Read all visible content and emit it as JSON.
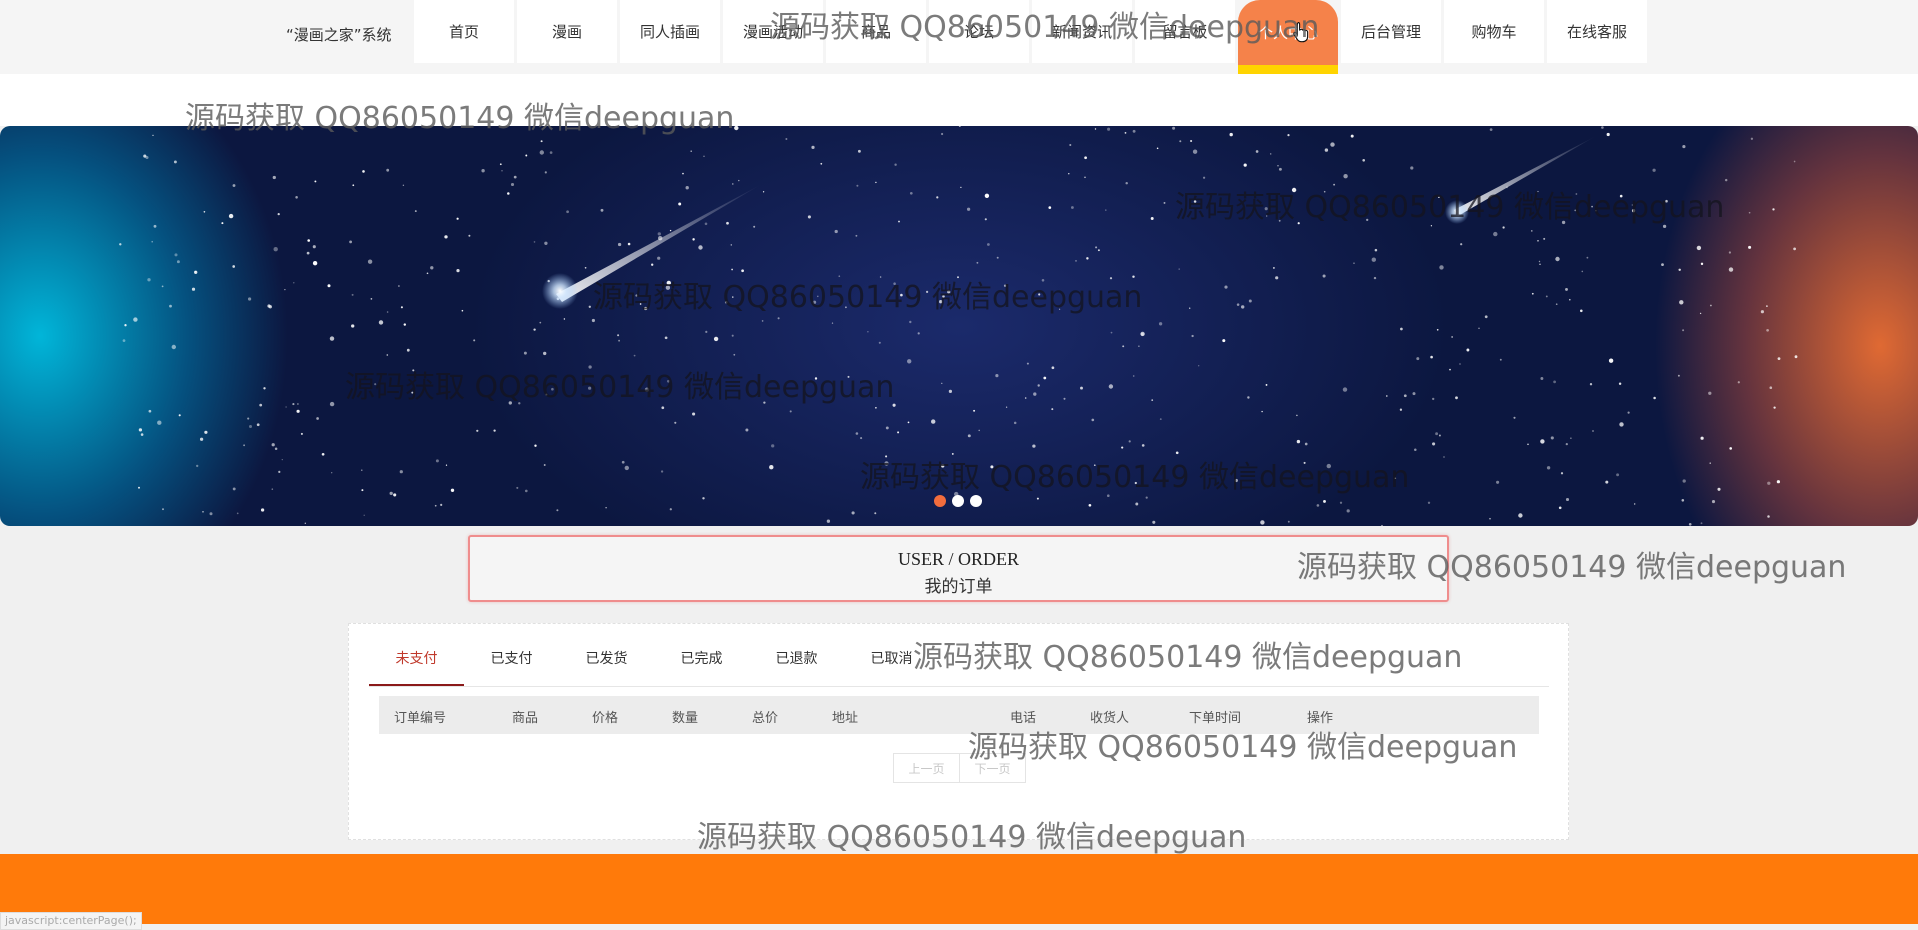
{
  "logo": "“漫画之家”系统",
  "nav": [
    {
      "label": "首页"
    },
    {
      "label": "漫画"
    },
    {
      "label": "同人插画"
    },
    {
      "label": "漫画活动"
    },
    {
      "label": "商品"
    },
    {
      "label": "论坛"
    },
    {
      "label": "新闻资讯"
    },
    {
      "label": "留言板"
    },
    {
      "label": "个人中心",
      "active": true
    },
    {
      "label": "后台管理"
    },
    {
      "label": "购物车"
    },
    {
      "label": "在线客服"
    }
  ],
  "banner": {
    "slides": 3,
    "active_slide": 1
  },
  "section": {
    "title_en": "USER / ORDER",
    "title_cn": "我的订单"
  },
  "tabs": [
    {
      "label": "未支付",
      "active": true
    },
    {
      "label": "已支付"
    },
    {
      "label": "已发货"
    },
    {
      "label": "已完成"
    },
    {
      "label": "已退款"
    },
    {
      "label": "已取消"
    }
  ],
  "columns": [
    "订单编号",
    "商品",
    "价格",
    "数量",
    "总价",
    "地址",
    "电话",
    "收货人",
    "下单时间",
    "操作"
  ],
  "pager": {
    "prev": "上一页",
    "next": "下一页"
  },
  "status_bar": "javascript:centerPage();",
  "watermark": "源码获取 QQ86050149 微信deepguan",
  "colors": {
    "accent": "#f5824a",
    "footer": "#ff7a0a",
    "active_tab": "#c0392b",
    "highlight": "#ffd400"
  }
}
